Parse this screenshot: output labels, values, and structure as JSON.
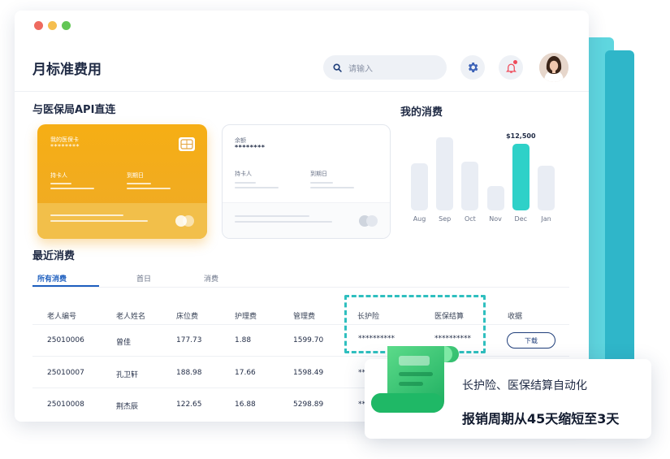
{
  "header": {
    "title": "月标准费用",
    "search_placeholder": "请输入"
  },
  "sections": {
    "api_title": "与医保局API直连",
    "consumption_title": "我的消费",
    "recent_title": "最近消费"
  },
  "card_gold": {
    "name": "我的医保卡",
    "number": "********",
    "holder_label": "持卡人",
    "expiry_label": "到期日"
  },
  "card_white": {
    "name": "余额",
    "number": "********",
    "holder_label": "持卡人",
    "expiry_label": "到期日"
  },
  "chart_data": {
    "type": "bar",
    "categories": [
      "Aug",
      "Sep",
      "Oct",
      "Nov",
      "Dec",
      "Jan"
    ],
    "values": [
      55,
      85,
      57,
      28,
      77,
      52
    ],
    "highlight_index": 4,
    "highlight_label": "$12,500",
    "colors": {
      "default": "#e9edf4",
      "active": "#2ed1c8"
    }
  },
  "tabs": [
    {
      "label": "所有消费",
      "active": true
    },
    {
      "label": "首日",
      "active": false
    },
    {
      "label": "消费",
      "active": false
    }
  ],
  "table": {
    "columns": [
      "老人编号",
      "老人姓名",
      "床位费",
      "护理费",
      "管理费",
      "长护险",
      "医保结算",
      "收据"
    ],
    "rows": [
      {
        "id": "25010006",
        "name": "曾佳",
        "bed": "177.73",
        "care": "1.88",
        "mgmt": "1599.70",
        "ltc": "**********",
        "ins": "**********",
        "action": "下载"
      },
      {
        "id": "25010007",
        "name": "孔卫轩",
        "bed": "188.98",
        "care": "17.66",
        "mgmt": "1598.49",
        "ltc": "**",
        "ins": "",
        "action": ""
      },
      {
        "id": "25010008",
        "name": "荆杰辰",
        "bed": "122.65",
        "care": "16.88",
        "mgmt": "5298.89",
        "ltc": "**",
        "ins": "",
        "action": ""
      }
    ]
  },
  "promo": {
    "line1": "长护险、医保结算自动化",
    "line2": "报销周期从45天缩短至3天"
  },
  "colors": {
    "accent_blue": "#1e5fbf",
    "teal": "#2ed1c8",
    "gold": "#f6ae14"
  }
}
